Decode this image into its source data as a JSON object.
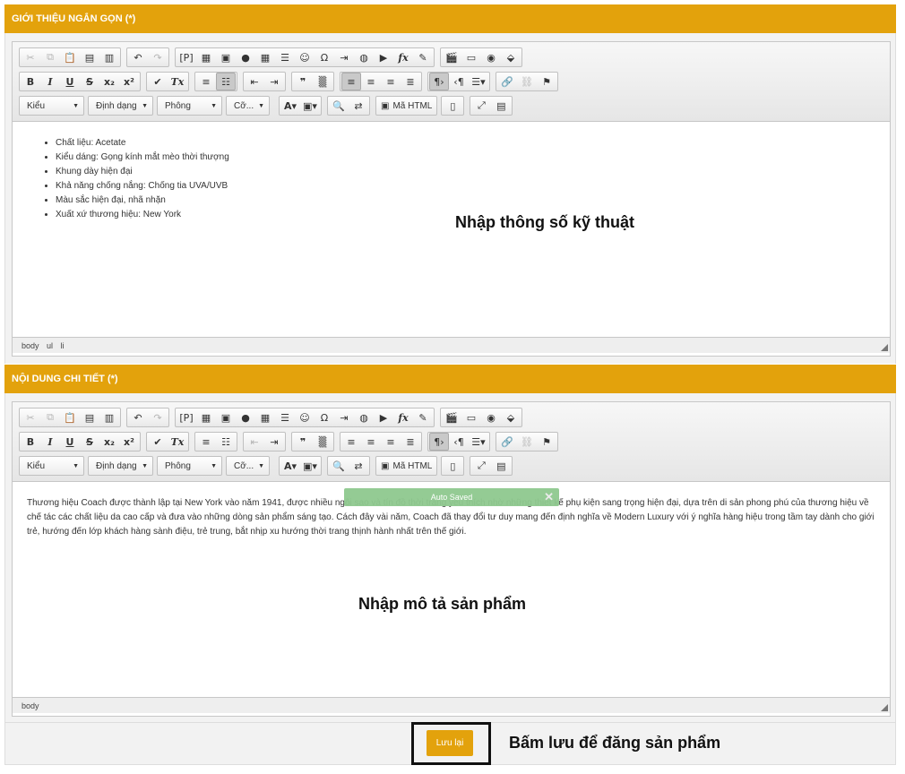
{
  "section1": {
    "header": "GIỚI THIỆU NGẮN GỌN (*)",
    "combos": {
      "style": "Kiểu",
      "format": "Định dạng",
      "font": "Phông",
      "size": "Cỡ..."
    },
    "html_button": "Mã HTML",
    "specs": [
      "Chất liệu: Acetate",
      "Kiểu dáng: Gọng kính mắt mèo thời thượng",
      "Khung dày hiện đại",
      "Khả năng chống nắng: Chống tia UVA/UVB",
      "Màu sắc hiện đại, nhã nhặn",
      "Xuất xứ thương hiệu: New York"
    ],
    "annotation": "Nhập thông số kỹ thuật",
    "status_path": [
      "body",
      "ul",
      "li"
    ]
  },
  "section2": {
    "header": "NỘI DUNG CHI TIẾT (*)",
    "combos": {
      "style": "Kiểu",
      "format": "Định dạng",
      "font": "Phông",
      "size": "Cỡ..."
    },
    "html_button": "Mã HTML",
    "body_text": "Thương hiệu Coach được thành lập tại New York vào năm 1941, được nhiều ngôi sao và tín đồ thời trang yêu thích nhờ những thiết kế phụ kiện sang trọng hiện đại, dựa trên di sản phong phú của thương hiệu về chế tác các chất liệu da cao cấp và đưa vào những dòng sản phẩm sáng tạo. Cách đây vài năm, Coach đã thay đổi tư duy mang đến định nghĩa về Modern Luxury với ý nghĩa hàng hiệu trong tầm tay dành cho giới trẻ, hướng đến lớp khách hàng sành điệu, trẻ trung, bắt nhịp xu hướng thời trang thịnh hành nhất trên thế giới.",
    "annotation": "Nhập mô tả sản phẩm",
    "status_path": [
      "body"
    ],
    "autosave": "Auto Saved"
  },
  "save_button": "Lưu lại",
  "save_annotation": "Bấm lưu để đăng sản phẩm"
}
